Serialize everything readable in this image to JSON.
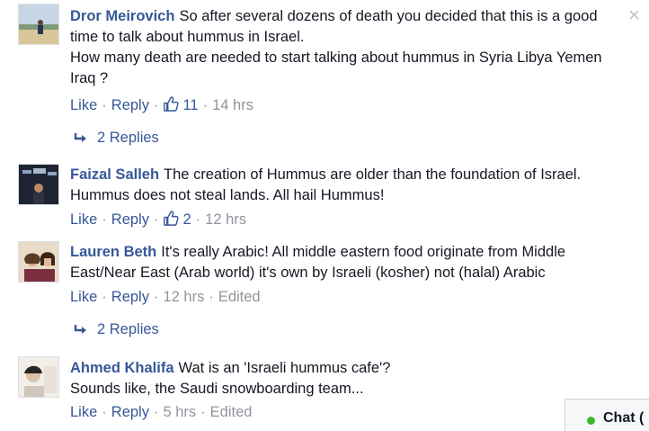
{
  "comments": [
    {
      "author": "Dror Meirovich",
      "text": "So after several dozens of death you decided that this is a good time to talk about hummus in Israel.",
      "text2": "How many death are needed to start talking about hummus in Syria Libya Yemen Iraq ?",
      "like_label": "Like",
      "reply_label": "Reply",
      "like_count": "11",
      "time": "14 hrs",
      "replies_label": "2 Replies"
    },
    {
      "author": "Faizal Salleh",
      "text": "The creation of Hummus are older than the foundation of Israel. Hummus does not steal lands. All hail Hummus!",
      "like_label": "Like",
      "reply_label": "Reply",
      "like_count": "2",
      "time": "12 hrs"
    },
    {
      "author": "Lauren Beth",
      "text": "It's really Arabic! All middle eastern food originate from Middle East/Near East (Arab world) it's own by Israeli (kosher) not (halal) Arabic",
      "like_label": "Like",
      "reply_label": "Reply",
      "time": "12 hrs",
      "edited": "Edited",
      "replies_label": "2 Replies"
    },
    {
      "author": "Ahmed Khalifa",
      "text": "Wat is an 'Israeli hummus cafe'?",
      "text2": "Sounds like, the Saudi snowboarding team...",
      "like_label": "Like",
      "reply_label": "Reply",
      "time": "5 hrs",
      "edited": "Edited"
    }
  ],
  "close_icon": "×",
  "chat": {
    "label": "Chat ("
  },
  "colors": {
    "link": "#365899",
    "meta": "#90949c",
    "online": "#42b72a"
  }
}
